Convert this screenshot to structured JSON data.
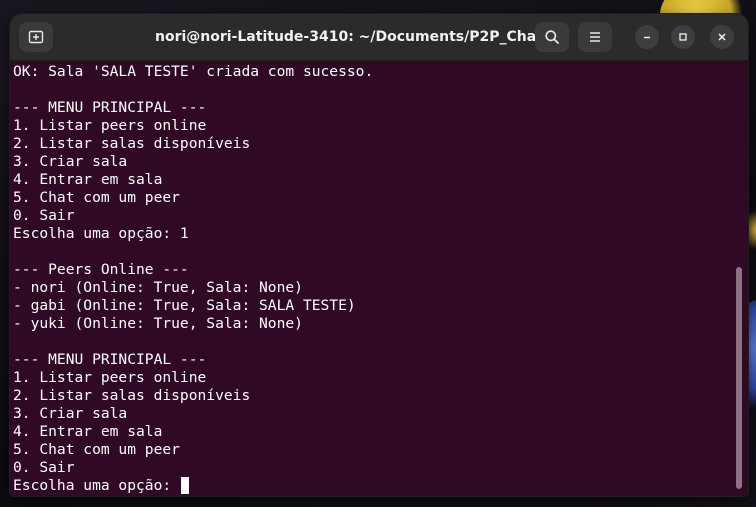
{
  "window": {
    "title": "nori@nori-Latitude-3410: ~/Documents/P2P_Chat"
  },
  "titlebar": {
    "new_tab_icon": "new-tab-icon",
    "search_icon": "search-icon",
    "menu_icon": "hamburger-menu-icon",
    "minimize_icon": "minimize-icon",
    "maximize_icon": "maximize-icon",
    "close_icon": "close-icon"
  },
  "colors": {
    "terminal_bg": "#300a24",
    "titlebar_bg": "#2b2b2b",
    "text": "#ffffff"
  },
  "terminal": {
    "lines": [
      "OK: Sala 'SALA TESTE' criada com sucesso.",
      "",
      "--- MENU PRINCIPAL ---",
      "1. Listar peers online",
      "2. Listar salas disponíveis",
      "3. Criar sala",
      "4. Entrar em sala",
      "5. Chat com um peer",
      "0. Sair",
      "Escolha uma opção: 1",
      "",
      "--- Peers Online ---",
      "- nori (Online: True, Sala: None)",
      "- gabi (Online: True, Sala: SALA TESTE)",
      "- yuki (Online: True, Sala: None)",
      "",
      "--- MENU PRINCIPAL ---",
      "1. Listar peers online",
      "2. Listar salas disponíveis",
      "3. Criar sala",
      "4. Entrar em sala",
      "5. Chat com um peer",
      "0. Sair"
    ],
    "prompt": "Escolha uma opção: "
  }
}
